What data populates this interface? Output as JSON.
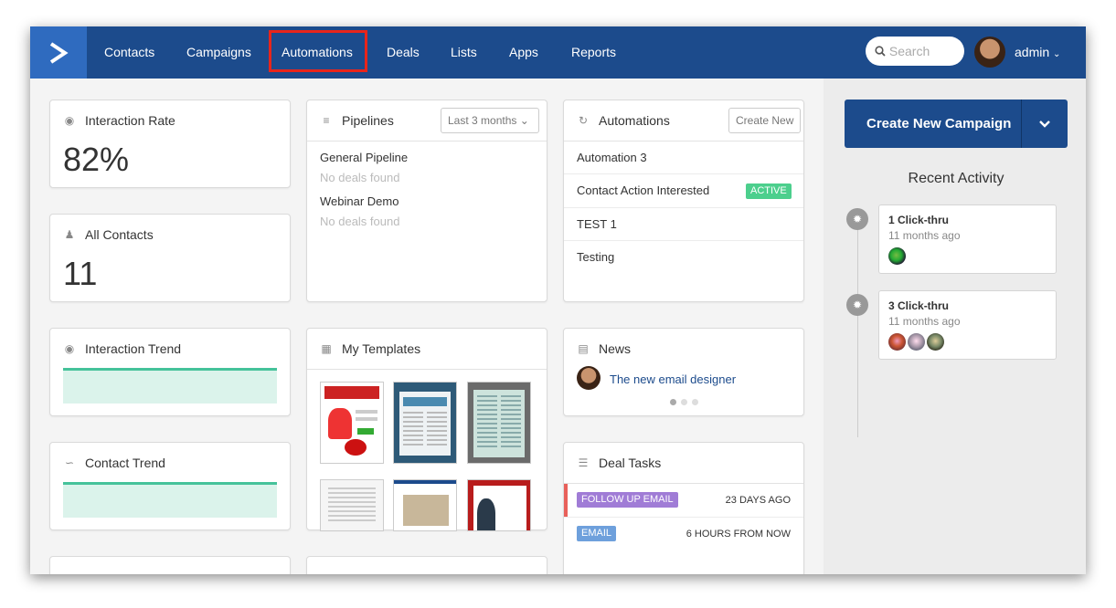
{
  "nav": {
    "items": [
      "Contacts",
      "Campaigns",
      "Automations",
      "Deals",
      "Lists",
      "Apps",
      "Reports"
    ],
    "search_placeholder": "Search",
    "user": "admin"
  },
  "interaction_rate": {
    "title": "Interaction Rate",
    "value": "82%"
  },
  "all_contacts": {
    "title": "All Contacts",
    "value": "11"
  },
  "interaction_trend": {
    "title": "Interaction Trend"
  },
  "contact_trend": {
    "title": "Contact Trend"
  },
  "pipelines": {
    "title": "Pipelines",
    "filter": "Last 3 months",
    "items": [
      {
        "name": "General Pipeline",
        "status": "No deals found"
      },
      {
        "name": "Webinar Demo",
        "status": "No deals found"
      }
    ]
  },
  "templates": {
    "title": "My Templates"
  },
  "automations": {
    "title": "Automations",
    "button": "Create New",
    "items": [
      {
        "name": "Automation 3",
        "badge": ""
      },
      {
        "name": "Contact Action Interested",
        "badge": "ACTIVE"
      },
      {
        "name": "TEST 1",
        "badge": ""
      },
      {
        "name": "Testing",
        "badge": ""
      }
    ]
  },
  "news": {
    "title": "News",
    "headline": "The new email designer"
  },
  "deal_tasks": {
    "title": "Deal Tasks",
    "items": [
      {
        "type": "FOLLOW UP EMAIL",
        "time": "23 DAYS AGO",
        "type_color": "#a07cd6"
      },
      {
        "type": "EMAIL",
        "time": "6 HOURS FROM NOW",
        "type_color": "#6ea0dc"
      }
    ]
  },
  "sidebar": {
    "create_button": "Create New Campaign",
    "recent_title": "Recent Activity",
    "activities": [
      {
        "title": "1 Click-thru",
        "time": "11 months ago"
      },
      {
        "title": "3 Click-thru",
        "time": "11 months ago"
      }
    ]
  },
  "colors": {
    "nav_bg": "#1c4b8c",
    "accent": "#2f6bbf",
    "active_badge": "#4ccf8d",
    "highlight": "#e8251b",
    "trend": "#45c29a"
  }
}
